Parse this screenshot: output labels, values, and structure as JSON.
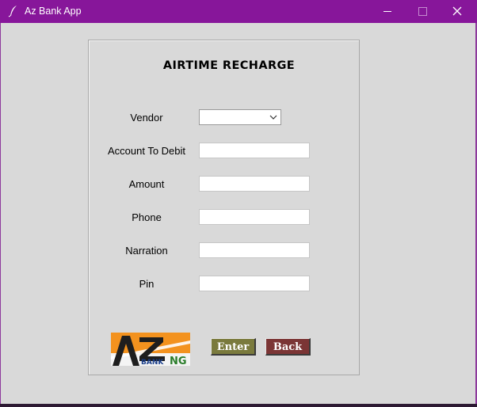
{
  "window": {
    "title": "Az Bank App",
    "icons": [
      "feather-icon",
      "minimize-icon",
      "maximize-icon",
      "close-icon"
    ]
  },
  "form": {
    "title": "AIRTIME RECHARGE",
    "fields": {
      "vendor": {
        "label": "Vendor",
        "value": ""
      },
      "account": {
        "label": "Account To Debit",
        "value": ""
      },
      "amount": {
        "label": "Amount",
        "value": ""
      },
      "phone": {
        "label": "Phone",
        "value": ""
      },
      "narration": {
        "label": "Narration",
        "value": ""
      },
      "pin": {
        "label": "Pin",
        "value": ""
      }
    }
  },
  "logo": {
    "top_text": "AZ",
    "bottom_text_a": "BANK",
    "bottom_text_b": "NG"
  },
  "buttons": {
    "enter": "Enter",
    "back": "Back"
  },
  "colors": {
    "titlebar": "#87169a",
    "enter_button": "#7a7a3d",
    "back_button": "#7b3535",
    "logo_orange": "#f3921e"
  }
}
